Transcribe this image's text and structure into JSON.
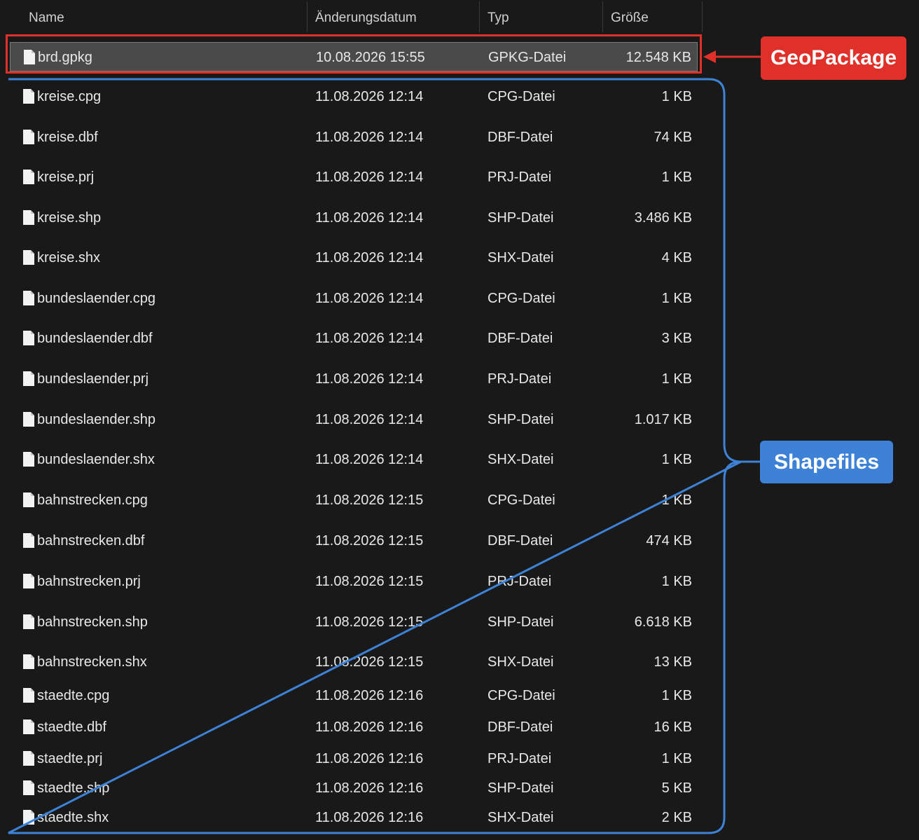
{
  "columns": {
    "name": "Name",
    "date": "Änderungsdatum",
    "type": "Typ",
    "size": "Größe"
  },
  "files": [
    {
      "name": "brd.gpkg",
      "date": "10.08.2026 15:55",
      "type": "GPKG-Datei",
      "size": "12.548 KB",
      "selected": true
    },
    {
      "name": "kreise.cpg",
      "date": "11.08.2026 12:14",
      "type": "CPG-Datei",
      "size": "1 KB"
    },
    {
      "name": "kreise.dbf",
      "date": "11.08.2026 12:14",
      "type": "DBF-Datei",
      "size": "74 KB"
    },
    {
      "name": "kreise.prj",
      "date": "11.08.2026 12:14",
      "type": "PRJ-Datei",
      "size": "1 KB"
    },
    {
      "name": "kreise.shp",
      "date": "11.08.2026 12:14",
      "type": "SHP-Datei",
      "size": "3.486 KB"
    },
    {
      "name": "kreise.shx",
      "date": "11.08.2026 12:14",
      "type": "SHX-Datei",
      "size": "4 KB"
    },
    {
      "name": "bundeslaender.cpg",
      "date": "11.08.2026 12:14",
      "type": "CPG-Datei",
      "size": "1 KB"
    },
    {
      "name": "bundeslaender.dbf",
      "date": "11.08.2026 12:14",
      "type": "DBF-Datei",
      "size": "3 KB"
    },
    {
      "name": "bundeslaender.prj",
      "date": "11.08.2026 12:14",
      "type": "PRJ-Datei",
      "size": "1 KB"
    },
    {
      "name": "bundeslaender.shp",
      "date": "11.08.2026 12:14",
      "type": "SHP-Datei",
      "size": "1.017 KB"
    },
    {
      "name": "bundeslaender.shx",
      "date": "11.08.2026 12:14",
      "type": "SHX-Datei",
      "size": "1 KB"
    },
    {
      "name": "bahnstrecken.cpg",
      "date": "11.08.2026 12:15",
      "type": "CPG-Datei",
      "size": "1 KB"
    },
    {
      "name": "bahnstrecken.dbf",
      "date": "11.08.2026 12:15",
      "type": "DBF-Datei",
      "size": "474 KB"
    },
    {
      "name": "bahnstrecken.prj",
      "date": "11.08.2026 12:15",
      "type": "PRJ-Datei",
      "size": "1 KB"
    },
    {
      "name": "bahnstrecken.shp",
      "date": "11.08.2026 12:15",
      "type": "SHP-Datei",
      "size": "6.618 KB"
    },
    {
      "name": "bahnstrecken.shx",
      "date": "11.08.2026 12:15",
      "type": "SHX-Datei",
      "size": "13 KB"
    },
    {
      "name": "staedte.cpg",
      "date": "11.08.2026 12:16",
      "type": "CPG-Datei",
      "size": "1 KB"
    },
    {
      "name": "staedte.dbf",
      "date": "11.08.2026 12:16",
      "type": "DBF-Datei",
      "size": "16 KB"
    },
    {
      "name": "staedte.prj",
      "date": "11.08.2026 12:16",
      "type": "PRJ-Datei",
      "size": "1 KB"
    },
    {
      "name": "staedte.shp",
      "date": "11.08.2026 12:16",
      "type": "SHP-Datei",
      "size": "5 KB"
    },
    {
      "name": "staedte.shx",
      "date": "11.08.2026 12:16",
      "type": "SHX-Datei",
      "size": "2 KB"
    }
  ],
  "annotations": {
    "geopackage": "GeoPackage",
    "shapefiles": "Shapefiles"
  },
  "colors": {
    "geopackage_accent": "#e0302a",
    "shapefiles_accent": "#3d82d6",
    "background": "#191919",
    "selection": "#4a4a4a"
  }
}
